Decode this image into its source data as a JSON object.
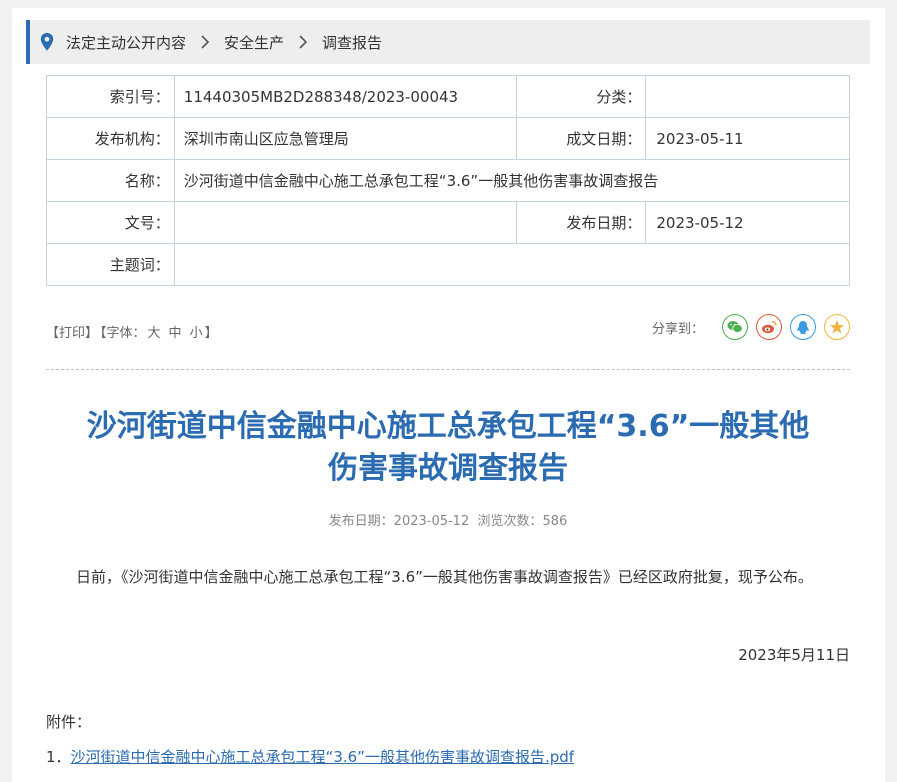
{
  "breadcrumb": [
    "法定主动公开内容",
    "安全生产",
    "调查报告"
  ],
  "info": {
    "index_label": "索引号：",
    "index_value": "11440305MB2D288348/2023-00043",
    "category_label": "分类：",
    "category_value": "",
    "org_label": "发布机构：",
    "org_value": "深圳市南山区应急管理局",
    "created_label": "成文日期：",
    "created_value": "2023-05-11",
    "name_label": "名称：",
    "name_value": "沙河街道中信金融中心施工总承包工程“3.6”一般其他伤害事故调查报告",
    "docno_label": "文号：",
    "docno_value": "",
    "pub_label": "发布日期：",
    "pub_value": "2023-05-12",
    "keyword_label": "主题词：",
    "keyword_value": ""
  },
  "tools": {
    "print": "【打印】",
    "font_prefix": "【字体：",
    "font_large": "大",
    "font_medium": "中",
    "font_small": "小",
    "font_suffix": "】",
    "share_label": "分享到：",
    "share_icons": [
      "wechat-icon",
      "weibo-icon",
      "qq-icon",
      "qzone-icon"
    ],
    "share_colors": [
      "#4caf50",
      "#e2583e",
      "#3a9be0",
      "#f0b43c"
    ]
  },
  "article": {
    "title_line1": "沙河街道中信金融中心施工总承包工程“3.6”一般其他",
    "title_line2": "伤害事故调查报告",
    "meta": "发布日期：2023-05-12  浏览次数：586",
    "body": "日前，《沙河街道中信金融中心施工总承包工程“3.6”一般其他伤害事故调查报告》已经区政府批复，现予公布。",
    "date": "2023年5月11日",
    "attachment_label": "附件：",
    "attachment_index": "1．",
    "attachment_link": "沙河街道中信金融中心施工总承包工程“3.6”一般其他伤害事故调查报告.pdf"
  },
  "colors": {
    "accent": "#2a6bb1",
    "border": "#c5d3e0"
  }
}
